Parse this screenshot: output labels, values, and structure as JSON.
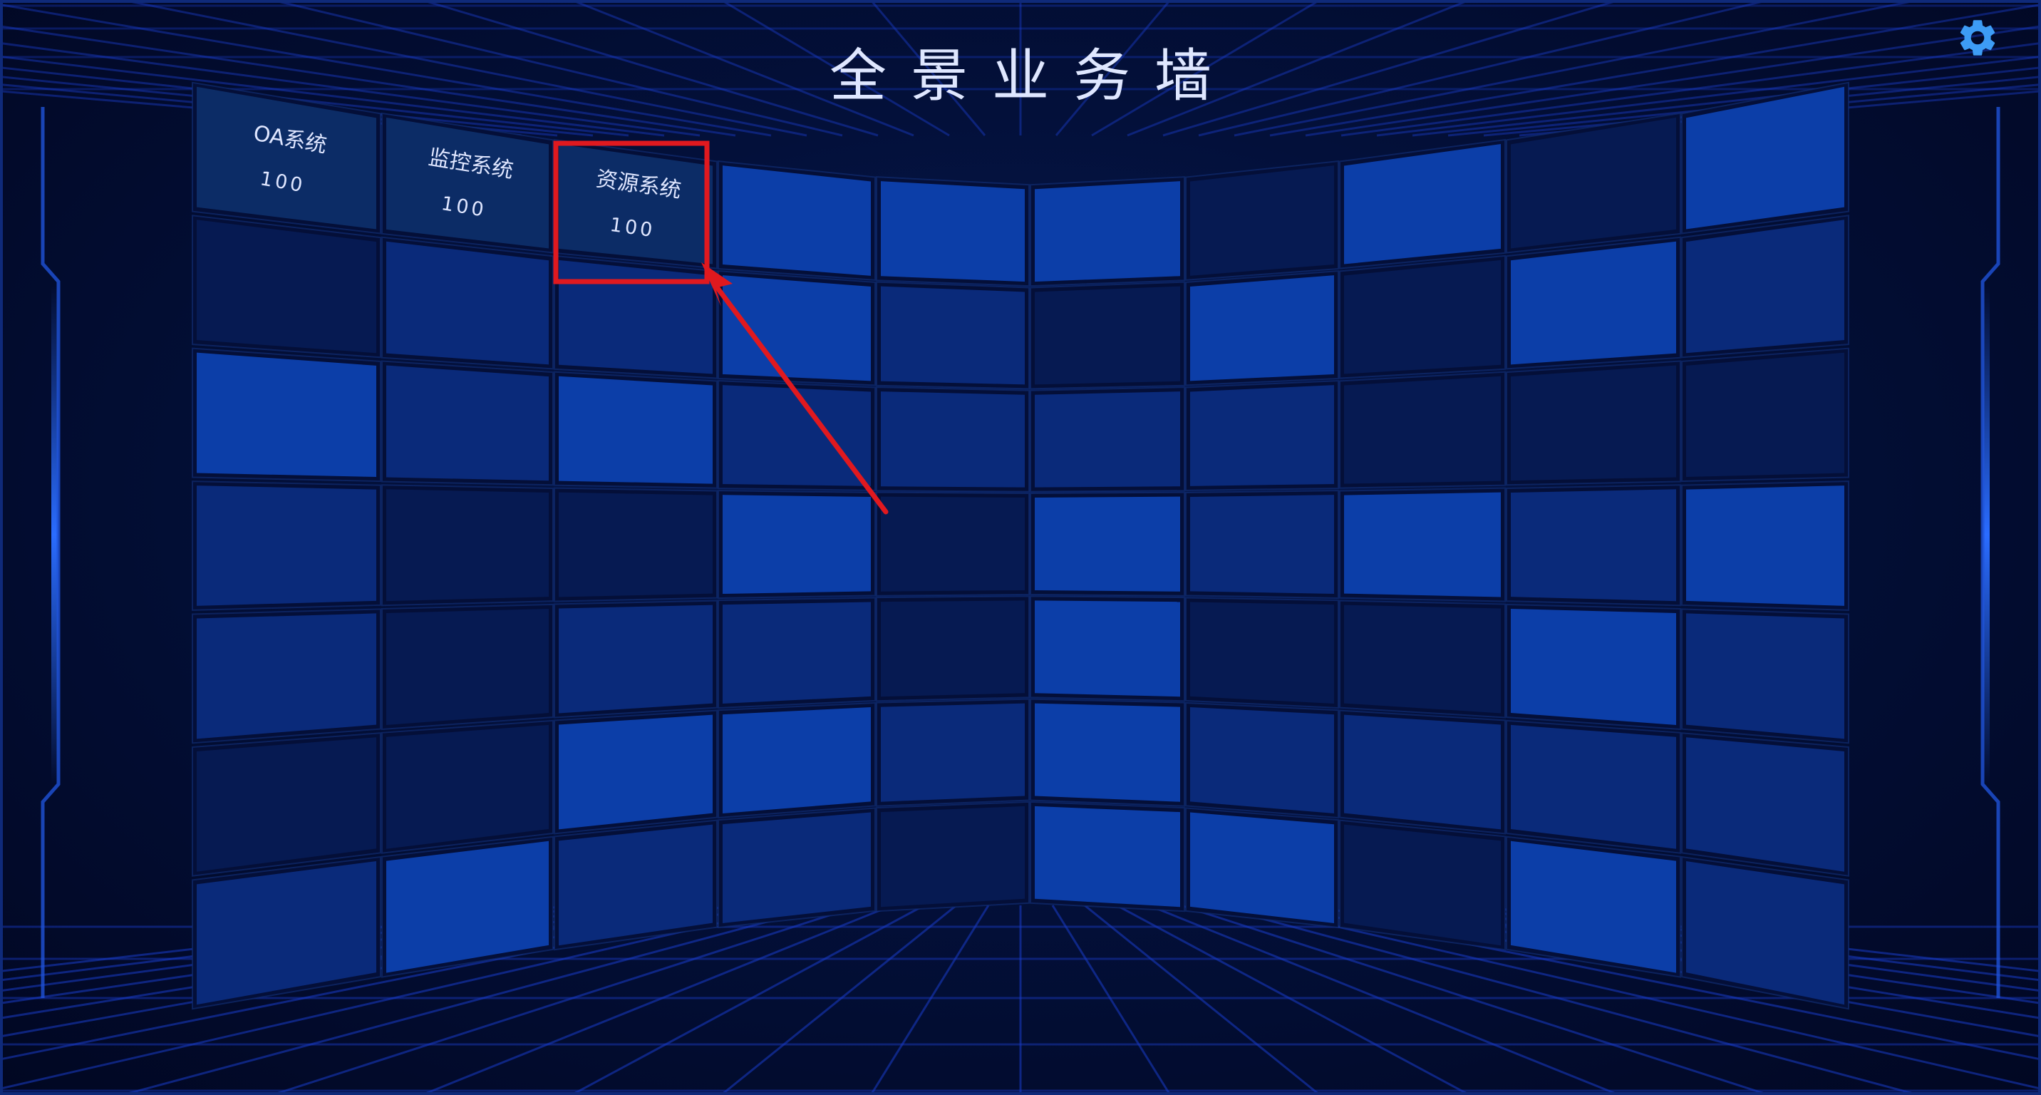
{
  "header": {
    "title": "全景业务墙"
  },
  "settings": {
    "icon": "gear-icon",
    "color": "#3d9cf5"
  },
  "wall": {
    "columns": 10,
    "rows": 7,
    "labeled_tiles": [
      {
        "col": 0,
        "row": 0,
        "name": "OA系统",
        "value": "100"
      },
      {
        "col": 1,
        "row": 0,
        "name": "监控系统",
        "value": "100"
      },
      {
        "col": 2,
        "row": 0,
        "name": "资源系统",
        "value": "100"
      }
    ],
    "highlighted_tile": {
      "col": 2,
      "row": 0
    }
  },
  "colors": {
    "background": "#020a2a",
    "tile_base": "#0a2a7a",
    "tile_bright": "#0c3ea8",
    "tile_dark": "#061a52",
    "highlight": "#e0191f",
    "accent": "#2a6cff"
  }
}
